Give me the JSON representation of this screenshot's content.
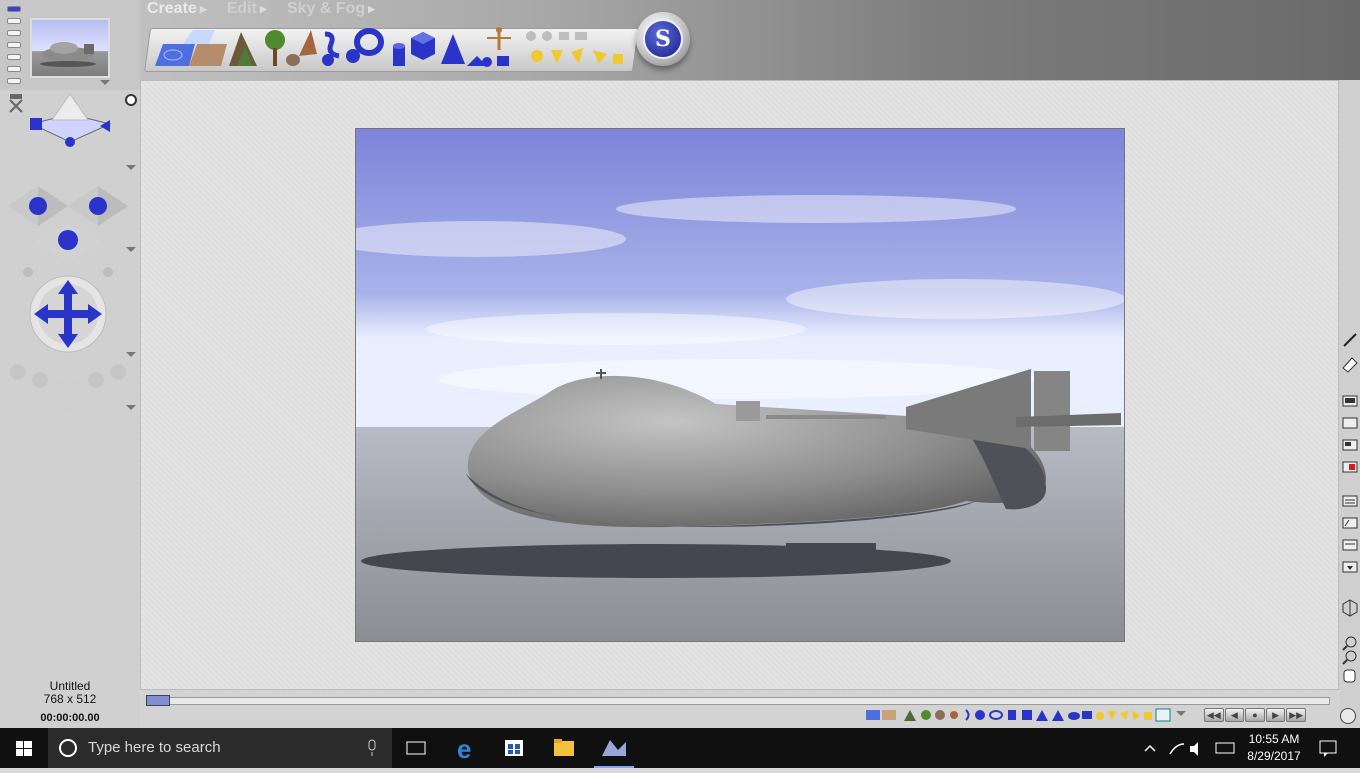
{
  "menu": {
    "create": "Create",
    "edit": "Edit",
    "sky_fog": "Sky & Fog"
  },
  "logo": {
    "letter": "S"
  },
  "document": {
    "name": "Untitled",
    "size": "768 x 512",
    "timecode": "00:00:00.00"
  },
  "taskbar": {
    "search_placeholder": "Type here to search",
    "time": "10:55 AM",
    "date": "8/29/2017"
  },
  "colors": {
    "accent_blue": "#2a34c8",
    "sky_top": "#7d84d9",
    "ground": "#8f9096",
    "taskbar": "#101010"
  },
  "icons": {
    "toolbar_objects": [
      "water-plane-icon",
      "infinite-plane-icon",
      "ground-plane-icon",
      "terrain-icon",
      "tree-icon",
      "rock-icon",
      "spiral-icon",
      "torus-icon",
      "cylinder-icon",
      "cube-icon",
      "pyramid-icon",
      "figure-icon",
      "light-icon"
    ],
    "right_strip": [
      "paintbrush-icon",
      "eraser-icon",
      "render-settings-icon",
      "render-area-icon",
      "render-icon",
      "stop-render-icon",
      "list-icon",
      "text-icon",
      "edit-icon",
      "menu-icon",
      "wireframe-cube-icon",
      "zoom-in-icon",
      "zoom-out-icon",
      "hand-icon"
    ]
  }
}
